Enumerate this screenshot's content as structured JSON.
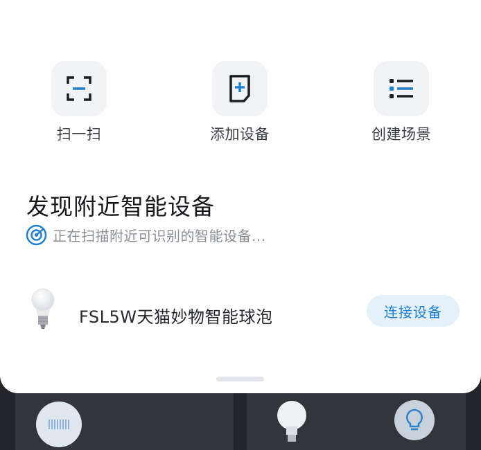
{
  "actions": {
    "scan": {
      "label": "扫一扫",
      "icon": "scan-icon"
    },
    "add_device": {
      "label": "添加设备",
      "icon": "add-device-icon"
    },
    "create_scene": {
      "label": "创建场景",
      "icon": "list-icon"
    }
  },
  "discover": {
    "title": "发现附近智能设备",
    "status": "正在扫描附近可识别的智能设备..."
  },
  "devices": [
    {
      "name": "FSL5W天猫妙物智能球泡",
      "icon": "light-bulb-icon",
      "action_label": "连接设备"
    }
  ],
  "colors": {
    "accent": "#1e7fd3",
    "button_bg": "#e4f1fb",
    "tile_bg": "#f2f3f6",
    "sheet_bg": "#ffffff",
    "backdrop": "#23252b"
  }
}
